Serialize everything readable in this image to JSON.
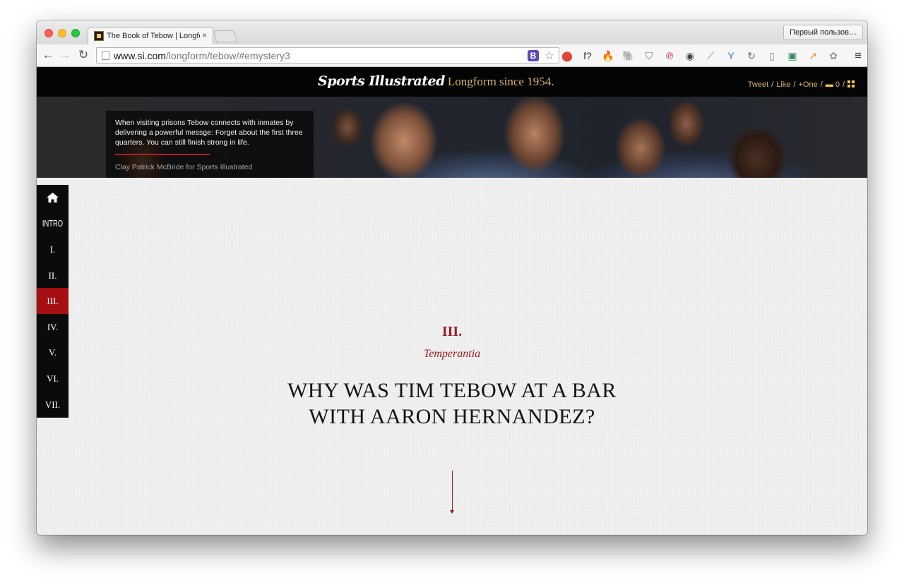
{
  "browser": {
    "tab_title": "The Book of Tebow | Longform",
    "tab_close": "×",
    "profile_button": "Первый пользов…",
    "url_host": "www.si.com",
    "url_path": "/longform/tebow/#emystery3",
    "extension_b": "B",
    "extensions": [
      "pdf-icon",
      "function-icon",
      "fire-icon",
      "evernote-icon",
      "pocket-icon",
      "pinterest-icon",
      "lens-icon",
      "eyedropper-icon",
      "y-icon",
      "refresh-circle-icon",
      "reader-icon",
      "tm-icon",
      "analytics-icon",
      "paw-icon"
    ],
    "extension_glyphs": [
      "⬤",
      "f?",
      "🔥",
      "🐘",
      "⛉",
      "℗",
      "◉",
      "⟋",
      "Y",
      "↻",
      "▯",
      "▣",
      "↗",
      "✿"
    ]
  },
  "page": {
    "brand_name": "Sports Illustrated",
    "brand_tagline": "Longform since 1954.",
    "share": {
      "tweet": "Tweet",
      "like": "Like",
      "plus_one": "+One",
      "comments_count": "0",
      "separator": "/"
    },
    "hero": {
      "caption": "When visiting prisons Tebow connects with inmates by delivering a powerful messge: Forget about the first three quarters. You can still finish strong in life.",
      "credit": "Clay Patrick McBride for Sports Illustrated"
    },
    "chapter_nav": {
      "intro": "INTRO",
      "items": [
        "I.",
        "II.",
        "III.",
        "IV.",
        "V.",
        "VI.",
        "VII."
      ],
      "active": "III."
    },
    "chapter": {
      "numeral": "III.",
      "subtitle": "Temperantia",
      "headline_line1": "WHY WAS TIM TEBOW AT A BAR",
      "headline_line2": "WITH AARON HERNANDEZ?"
    }
  },
  "colors": {
    "accent_red": "#9b1a1d",
    "nav_active": "#a50f12",
    "brand_gold": "#d8b66a"
  }
}
